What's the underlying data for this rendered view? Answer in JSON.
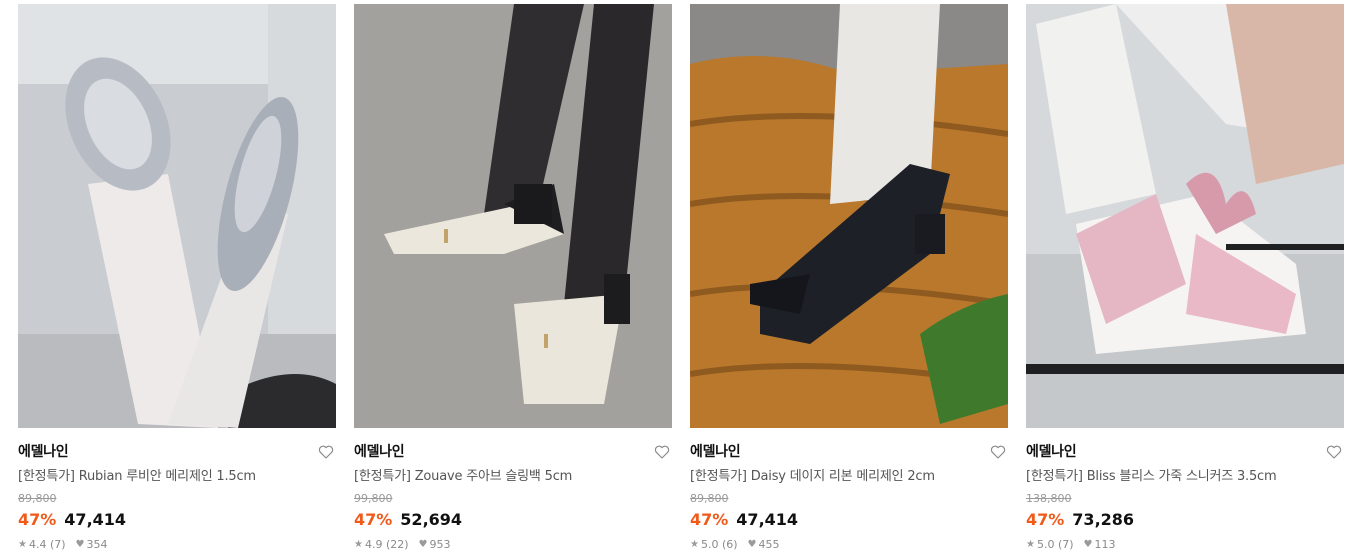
{
  "products": [
    {
      "brand": "에델나인",
      "title": "[한정특가] Rubian 루비안 메리제인 1.5cm",
      "original_price": "89,800",
      "discount": "47%",
      "price": "47,414",
      "rating": "4.4 (7)",
      "likes": "354"
    },
    {
      "brand": "에델나인",
      "title": "[한정특가] Zouave 주아브 슬링백 5cm",
      "original_price": "99,800",
      "discount": "47%",
      "price": "52,694",
      "rating": "4.9 (22)",
      "likes": "953"
    },
    {
      "brand": "에델나인",
      "title": "[한정특가] Daisy 데이지 리본 메리제인 2cm",
      "original_price": "89,800",
      "discount": "47%",
      "price": "47,414",
      "rating": "5.0 (6)",
      "likes": "455"
    },
    {
      "brand": "에델나인",
      "title": "[한정특가] Bliss 블리스 가죽 스니커즈 3.5cm",
      "original_price": "138,800",
      "discount": "47%",
      "price": "73,286",
      "rating": "5.0 (7)",
      "likes": "113"
    }
  ],
  "icons": {
    "wishlist": "heart-outline-icon",
    "rating": "star-icon",
    "likes": "heart-filled-icon"
  },
  "colors": {
    "discount": "#f05a1a",
    "strike_price": "#9a9a9a"
  }
}
